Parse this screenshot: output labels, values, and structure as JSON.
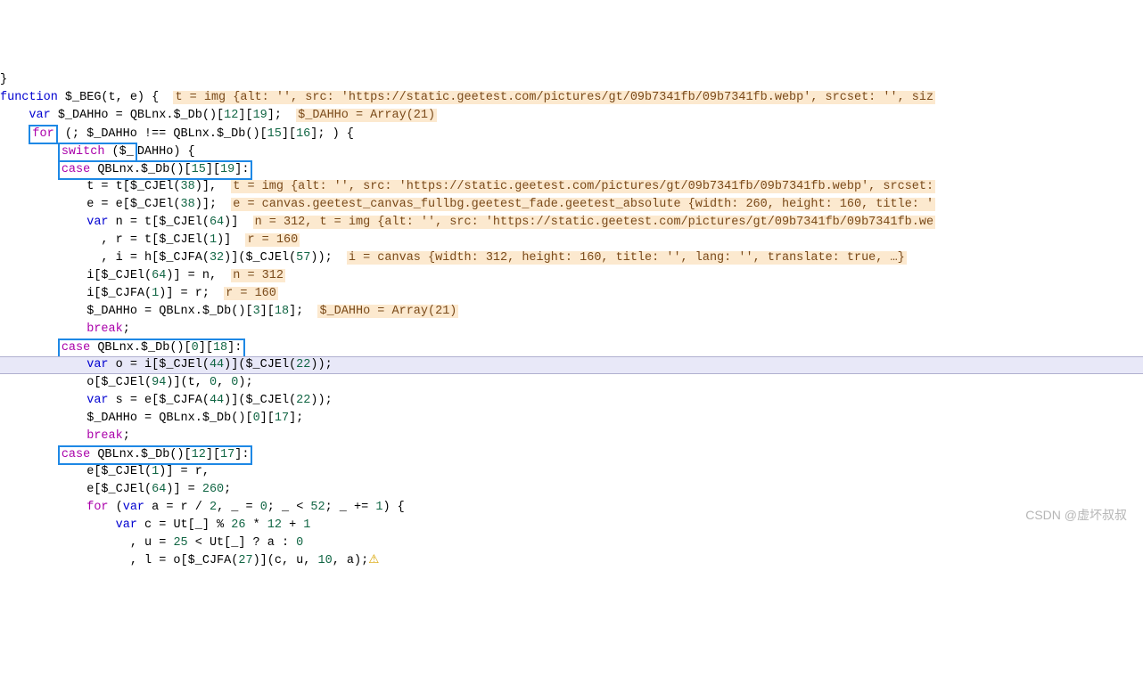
{
  "watermark": "CSDN @虚坏叔叔",
  "lines": [
    {
      "indent": 0,
      "segments": [
        {
          "t": "plain",
          "v": "}"
        }
      ]
    },
    {
      "indent": 0,
      "segments": [
        {
          "t": "kw-decl",
          "v": "function"
        },
        {
          "t": "plain",
          "v": " $_BEG(t, e) {  "
        },
        {
          "t": "hint",
          "v": "t = img {alt: '', src: 'https://static.geetest.com/pictures/gt/09b7341fb/09b7341fb.webp', srcset: '', siz"
        }
      ]
    },
    {
      "indent": 4,
      "segments": [
        {
          "t": "kw-decl",
          "v": "var"
        },
        {
          "t": "plain",
          "v": " $_DAHHo = QBLnx.$_Db()["
        },
        {
          "t": "num",
          "v": "12"
        },
        {
          "t": "plain",
          "v": "]["
        },
        {
          "t": "num",
          "v": "19"
        },
        {
          "t": "plain",
          "v": "];  "
        },
        {
          "t": "hint",
          "v": "$_DAHHo = Array(21)"
        }
      ]
    },
    {
      "indent": 4,
      "segments": [
        {
          "t": "box",
          "inner": [
            {
              "t": "kw-control",
              "v": "for"
            }
          ]
        },
        {
          "t": "plain",
          "v": " (; $_DAHHo !== QBLnx.$_Db()["
        },
        {
          "t": "num",
          "v": "15"
        },
        {
          "t": "plain",
          "v": "]["
        },
        {
          "t": "num",
          "v": "16"
        },
        {
          "t": "plain",
          "v": "]; ) {"
        }
      ]
    },
    {
      "indent": 8,
      "segments": [
        {
          "t": "box",
          "inner": [
            {
              "t": "kw-control",
              "v": "switch"
            },
            {
              "t": "plain",
              "v": " ($_"
            }
          ]
        },
        {
          "t": "plain",
          "v": "DAHHo) {"
        }
      ]
    },
    {
      "indent": 8,
      "segments": [
        {
          "t": "box",
          "inner": [
            {
              "t": "kw-control",
              "v": "case"
            },
            {
              "t": "plain",
              "v": " QBLnx.$_Db()["
            },
            {
              "t": "num",
              "v": "15"
            },
            {
              "t": "plain",
              "v": "]["
            },
            {
              "t": "num",
              "v": "19"
            },
            {
              "t": "plain",
              "v": "]:"
            }
          ]
        }
      ]
    },
    {
      "indent": 12,
      "segments": [
        {
          "t": "plain",
          "v": "t = t[$_CJEl("
        },
        {
          "t": "num",
          "v": "38"
        },
        {
          "t": "plain",
          "v": ")],  "
        },
        {
          "t": "hint",
          "v": "t = img {alt: '', src: 'https://static.geetest.com/pictures/gt/09b7341fb/09b7341fb.webp', srcset:"
        }
      ]
    },
    {
      "indent": 12,
      "segments": [
        {
          "t": "plain",
          "v": "e = e[$_CJEl("
        },
        {
          "t": "num",
          "v": "38"
        },
        {
          "t": "plain",
          "v": ")];  "
        },
        {
          "t": "hint",
          "v": "e = canvas.geetest_canvas_fullbg.geetest_fade.geetest_absolute {width: 260, height: 160, title: '"
        }
      ]
    },
    {
      "indent": 12,
      "segments": [
        {
          "t": "kw-decl",
          "v": "var"
        },
        {
          "t": "plain",
          "v": " n = t[$_CJEl("
        },
        {
          "t": "num",
          "v": "64"
        },
        {
          "t": "plain",
          "v": ")]  "
        },
        {
          "t": "hint",
          "v": "n = 312, t = img {alt: '', src: 'https://static.geetest.com/pictures/gt/09b7341fb/09b7341fb.we"
        }
      ]
    },
    {
      "indent": 14,
      "segments": [
        {
          "t": "plain",
          "v": ", r = t[$_CJEl("
        },
        {
          "t": "num",
          "v": "1"
        },
        {
          "t": "plain",
          "v": ")]  "
        },
        {
          "t": "hint",
          "v": "r = 160"
        }
      ]
    },
    {
      "indent": 14,
      "segments": [
        {
          "t": "plain",
          "v": ", i = h[$_CJFA("
        },
        {
          "t": "num",
          "v": "32"
        },
        {
          "t": "plain",
          "v": ")]($_CJEl("
        },
        {
          "t": "num",
          "v": "57"
        },
        {
          "t": "plain",
          "v": "));  "
        },
        {
          "t": "hint",
          "v": "i = canvas {width: 312, height: 160, title: '', lang: '', translate: true, …}"
        }
      ]
    },
    {
      "indent": 12,
      "segments": [
        {
          "t": "plain",
          "v": "i[$_CJEl("
        },
        {
          "t": "num",
          "v": "64"
        },
        {
          "t": "plain",
          "v": ")] = n,  "
        },
        {
          "t": "hint",
          "v": "n = 312"
        }
      ]
    },
    {
      "indent": 12,
      "segments": [
        {
          "t": "plain",
          "v": "i[$_CJFA("
        },
        {
          "t": "num",
          "v": "1"
        },
        {
          "t": "plain",
          "v": ")] = r;  "
        },
        {
          "t": "hint",
          "v": "r = 160"
        }
      ]
    },
    {
      "indent": 12,
      "segments": [
        {
          "t": "plain",
          "v": "$_DAHHo = QBLnx.$_Db()["
        },
        {
          "t": "num",
          "v": "3"
        },
        {
          "t": "plain",
          "v": "]["
        },
        {
          "t": "num",
          "v": "18"
        },
        {
          "t": "plain",
          "v": "];  "
        },
        {
          "t": "hint",
          "v": "$_DAHHo = Array(21)"
        }
      ]
    },
    {
      "indent": 12,
      "segments": [
        {
          "t": "kw-control",
          "v": "break"
        },
        {
          "t": "plain",
          "v": ";"
        }
      ]
    },
    {
      "indent": 8,
      "segments": [
        {
          "t": "box",
          "inner": [
            {
              "t": "kw-control",
              "v": "case"
            },
            {
              "t": "plain",
              "v": " QBLnx.$_Db()["
            },
            {
              "t": "num",
              "v": "0"
            },
            {
              "t": "plain",
              "v": "]["
            },
            {
              "t": "num",
              "v": "18"
            },
            {
              "t": "plain",
              "v": "]:"
            }
          ]
        }
      ]
    },
    {
      "indent": 12,
      "current": true,
      "segments": [
        {
          "t": "kw-decl",
          "v": "var"
        },
        {
          "t": "plain",
          "v": " o = i[$_CJEl("
        },
        {
          "t": "num",
          "v": "44"
        },
        {
          "t": "plain",
          "v": ")]($_CJEl("
        },
        {
          "t": "num",
          "v": "22"
        },
        {
          "t": "plain",
          "v": "));"
        }
      ]
    },
    {
      "indent": 12,
      "segments": [
        {
          "t": "plain",
          "v": "o[$_CJEl("
        },
        {
          "t": "num",
          "v": "94"
        },
        {
          "t": "plain",
          "v": ")](t, "
        },
        {
          "t": "num",
          "v": "0"
        },
        {
          "t": "plain",
          "v": ", "
        },
        {
          "t": "num",
          "v": "0"
        },
        {
          "t": "plain",
          "v": ");"
        }
      ]
    },
    {
      "indent": 12,
      "segments": [
        {
          "t": "kw-decl",
          "v": "var"
        },
        {
          "t": "plain",
          "v": " s = e[$_CJFA("
        },
        {
          "t": "num",
          "v": "44"
        },
        {
          "t": "plain",
          "v": ")]($_CJEl("
        },
        {
          "t": "num",
          "v": "22"
        },
        {
          "t": "plain",
          "v": "));"
        }
      ]
    },
    {
      "indent": 12,
      "segments": [
        {
          "t": "plain",
          "v": "$_DAHHo = QBLnx.$_Db()["
        },
        {
          "t": "num",
          "v": "0"
        },
        {
          "t": "plain",
          "v": "]["
        },
        {
          "t": "num",
          "v": "17"
        },
        {
          "t": "plain",
          "v": "];"
        }
      ]
    },
    {
      "indent": 12,
      "segments": [
        {
          "t": "kw-control",
          "v": "break"
        },
        {
          "t": "plain",
          "v": ";"
        }
      ]
    },
    {
      "indent": 8,
      "segments": [
        {
          "t": "box",
          "inner": [
            {
              "t": "kw-control",
              "v": "case"
            },
            {
              "t": "plain",
              "v": " QBLnx.$_Db()["
            },
            {
              "t": "num",
              "v": "12"
            },
            {
              "t": "plain",
              "v": "]["
            },
            {
              "t": "num",
              "v": "17"
            },
            {
              "t": "plain",
              "v": "]:"
            }
          ]
        }
      ]
    },
    {
      "indent": 12,
      "segments": [
        {
          "t": "plain",
          "v": "e[$_CJEl("
        },
        {
          "t": "num",
          "v": "1"
        },
        {
          "t": "plain",
          "v": ")] = r,"
        }
      ]
    },
    {
      "indent": 12,
      "segments": [
        {
          "t": "plain",
          "v": "e[$_CJEl("
        },
        {
          "t": "num",
          "v": "64"
        },
        {
          "t": "plain",
          "v": ")] = "
        },
        {
          "t": "num",
          "v": "260"
        },
        {
          "t": "plain",
          "v": ";"
        }
      ]
    },
    {
      "indent": 12,
      "segments": [
        {
          "t": "kw-control",
          "v": "for"
        },
        {
          "t": "plain",
          "v": " ("
        },
        {
          "t": "kw-decl",
          "v": "var"
        },
        {
          "t": "plain",
          "v": " a = r / "
        },
        {
          "t": "num",
          "v": "2"
        },
        {
          "t": "plain",
          "v": ", _ = "
        },
        {
          "t": "num",
          "v": "0"
        },
        {
          "t": "plain",
          "v": "; _ < "
        },
        {
          "t": "num",
          "v": "52"
        },
        {
          "t": "plain",
          "v": "; _ += "
        },
        {
          "t": "num",
          "v": "1"
        },
        {
          "t": "plain",
          "v": ") {"
        }
      ]
    },
    {
      "indent": 16,
      "segments": [
        {
          "t": "kw-decl",
          "v": "var"
        },
        {
          "t": "plain",
          "v": " c = Ut[_] % "
        },
        {
          "t": "num",
          "v": "26"
        },
        {
          "t": "plain",
          "v": " * "
        },
        {
          "t": "num",
          "v": "12"
        },
        {
          "t": "plain",
          "v": " + "
        },
        {
          "t": "num",
          "v": "1"
        }
      ]
    },
    {
      "indent": 18,
      "segments": [
        {
          "t": "plain",
          "v": ", u = "
        },
        {
          "t": "num",
          "v": "25"
        },
        {
          "t": "plain",
          "v": " < Ut[_] ? a : "
        },
        {
          "t": "num",
          "v": "0"
        }
      ]
    },
    {
      "indent": 18,
      "segments": [
        {
          "t": "plain",
          "v": ", l = o[$_CJFA("
        },
        {
          "t": "num",
          "v": "27"
        },
        {
          "t": "plain",
          "v": ")](c, u, "
        },
        {
          "t": "num",
          "v": "10"
        },
        {
          "t": "plain",
          "v": ", a);"
        },
        {
          "t": "warn",
          "v": "⚠"
        }
      ]
    }
  ]
}
